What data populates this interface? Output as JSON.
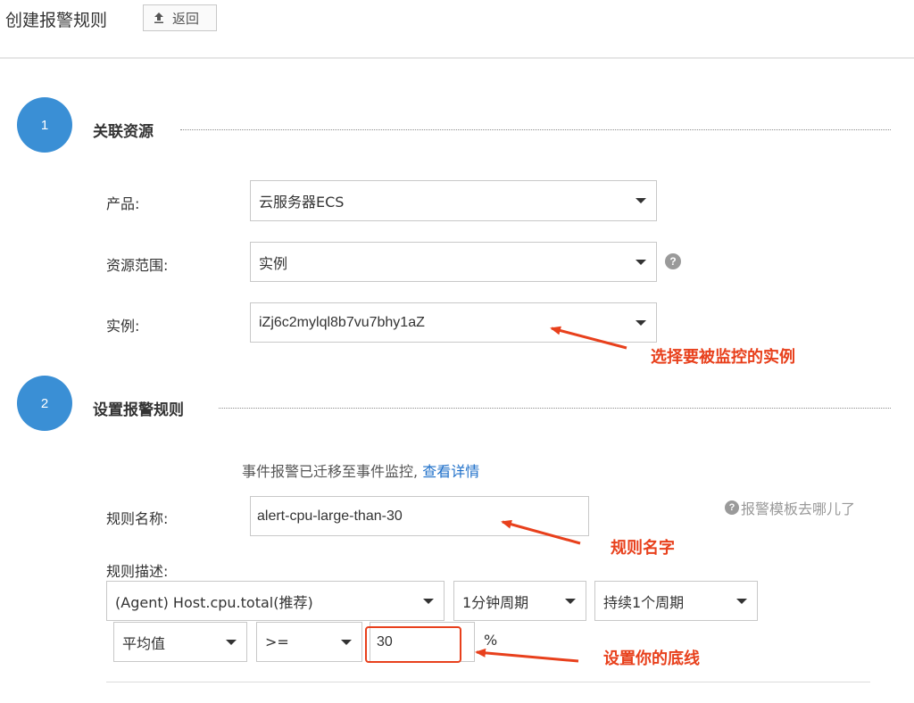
{
  "header": {
    "title": "创建报警规则",
    "back_label": "返回"
  },
  "step1": {
    "number": "1",
    "title": "关联资源",
    "product_label": "产品:",
    "product_value": "云服务器ECS",
    "scope_label": "资源范围:",
    "scope_value": "实例",
    "instance_label": "实例:",
    "instance_value": "iZj6c2mylql8b7vu7bhy1aZ"
  },
  "step2": {
    "number": "2",
    "title": "设置报警规则",
    "notice_text": "事件报警已迁移至事件监控, ",
    "notice_link": "查看详情",
    "rule_name_label": "规则名称:",
    "rule_name_value": "alert-cpu-large-than-30",
    "template_link": "报警模板去哪儿了",
    "rule_desc_label": "规则描述:",
    "metric_value": "(Agent) Host.cpu.total(推荐)",
    "period_value": "1分钟周期",
    "duration_value": "持续1个周期",
    "stat_value": "平均值",
    "operator_value": ">=",
    "threshold_value": "30",
    "unit": "%"
  },
  "annotations": {
    "instance_note": "选择要被监控的实例",
    "rule_name_note": "规则名字",
    "threshold_note": "设置你的底线"
  },
  "colors": {
    "accent": "#3a8fd5",
    "annotation": "#e8401c",
    "link": "#1e6fc9"
  }
}
